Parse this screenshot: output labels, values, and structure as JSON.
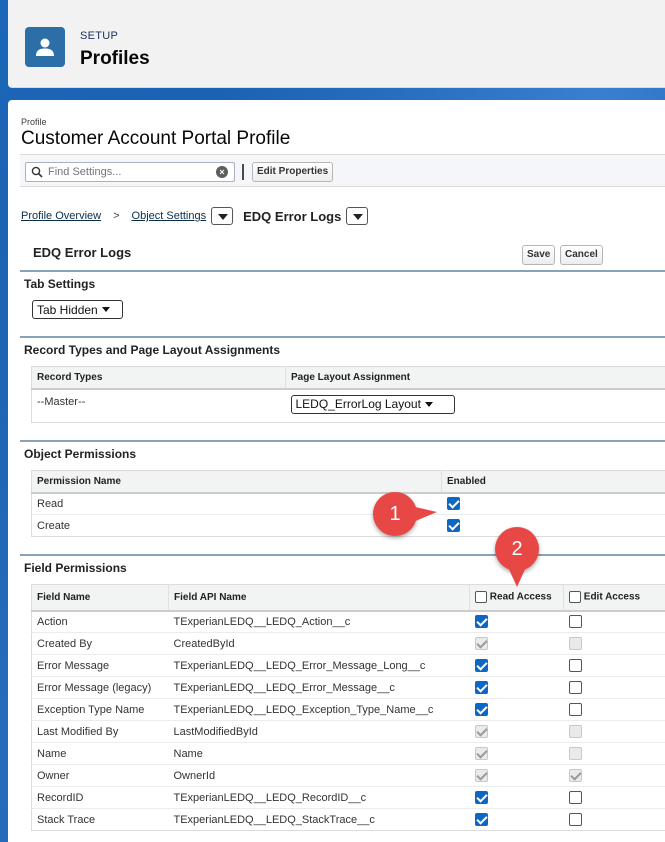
{
  "header": {
    "setup_label": "SETUP",
    "title": "Profiles",
    "icon": "user-profile-icon"
  },
  "profile": {
    "label": "Profile",
    "name": "Customer Account Portal Profile"
  },
  "toolbar": {
    "search_placeholder": "Find Settings...",
    "edit_properties": "Edit Properties"
  },
  "breadcrumb": {
    "overview": "Profile Overview",
    "separator": ">",
    "object_settings": "Object Settings",
    "current": "EDQ Error Logs"
  },
  "section": {
    "title": "EDQ Error Logs",
    "save": "Save",
    "cancel": "Cancel"
  },
  "tab_settings": {
    "title": "Tab Settings",
    "value": "Tab Hidden"
  },
  "record_types": {
    "title": "Record Types and Page Layout Assignments",
    "col_record_types": "Record Types",
    "col_layout": "Page Layout Assignment",
    "rows": [
      {
        "record_type": "--Master--",
        "layout": "LEDQ_ErrorLog Layout"
      }
    ]
  },
  "object_permissions": {
    "title": "Object Permissions",
    "col_name": "Permission Name",
    "col_enabled": "Enabled",
    "rows": [
      {
        "name": "Read",
        "enabled": true
      },
      {
        "name": "Create",
        "enabled": true
      }
    ]
  },
  "field_permissions": {
    "title": "Field Permissions",
    "col_field_name": "Field Name",
    "col_api_name": "Field API Name",
    "col_read": "Read Access",
    "col_edit": "Edit Access",
    "rows": [
      {
        "name": "Action",
        "api": "TExperianLEDQ__LEDQ_Action__c",
        "read": true,
        "read_disabled": false,
        "edit": false,
        "edit_disabled": false
      },
      {
        "name": "Created By",
        "api": "CreatedById",
        "read": true,
        "read_disabled": true,
        "edit": false,
        "edit_disabled": true
      },
      {
        "name": "Error Message",
        "api": "TExperianLEDQ__LEDQ_Error_Message_Long__c",
        "read": true,
        "read_disabled": false,
        "edit": false,
        "edit_disabled": false
      },
      {
        "name": "Error Message (legacy)",
        "api": "TExperianLEDQ__LEDQ_Error_Message__c",
        "read": true,
        "read_disabled": false,
        "edit": false,
        "edit_disabled": false
      },
      {
        "name": "Exception Type Name",
        "api": "TExperianLEDQ__LEDQ_Exception_Type_Name__c",
        "read": true,
        "read_disabled": false,
        "edit": false,
        "edit_disabled": false
      },
      {
        "name": "Last Modified By",
        "api": "LastModifiedById",
        "read": true,
        "read_disabled": true,
        "edit": false,
        "edit_disabled": true
      },
      {
        "name": "Name",
        "api": "Name",
        "read": true,
        "read_disabled": true,
        "edit": false,
        "edit_disabled": true
      },
      {
        "name": "Owner",
        "api": "OwnerId",
        "read": true,
        "read_disabled": true,
        "edit": true,
        "edit_disabled": true
      },
      {
        "name": "RecordID",
        "api": "TExperianLEDQ__LEDQ_RecordID__c",
        "read": true,
        "read_disabled": false,
        "edit": false,
        "edit_disabled": false
      },
      {
        "name": "Stack Trace",
        "api": "TExperianLEDQ__LEDQ_StackTrace__c",
        "read": true,
        "read_disabled": false,
        "edit": false,
        "edit_disabled": false
      }
    ]
  },
  "callouts": {
    "one": "1",
    "two": "2",
    "color": "#e84845"
  },
  "colors": {
    "accent": "#0b67c8",
    "brand_bg": "#1b5fa7",
    "header_icon": "#2c6ea8"
  }
}
